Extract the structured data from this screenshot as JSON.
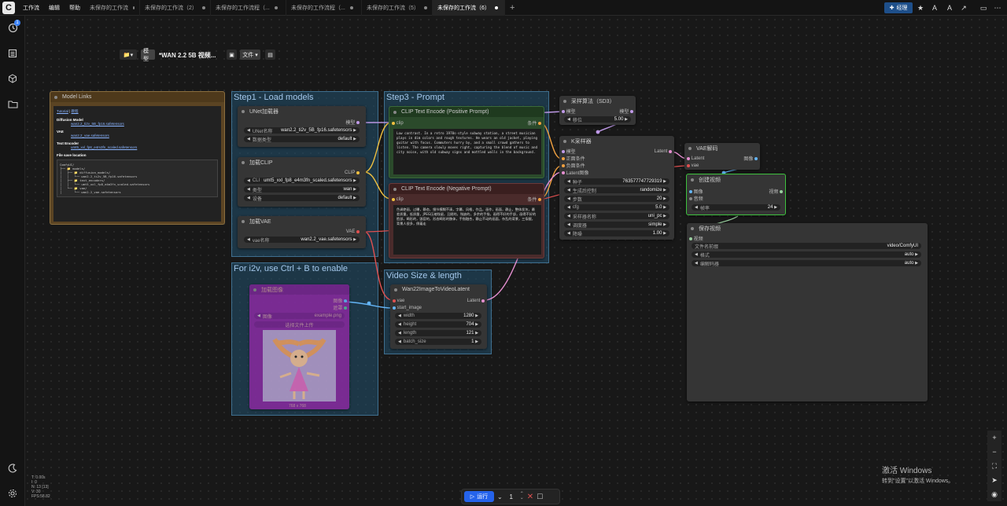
{
  "topbar": {
    "logo": "C",
    "menus": [
      "工作流",
      "编辑",
      "帮助"
    ],
    "tabs": [
      {
        "label": "未保存的工作流",
        "active": false
      },
      {
        "label": "未保存的工作流（2）",
        "active": false
      },
      {
        "label": "未保存的工作流程（...",
        "active": false
      },
      {
        "label": "未保存的工作流程（...",
        "active": false
      },
      {
        "label": "未保存的工作流（5）",
        "active": false
      },
      {
        "label": "未保存的工作流（6）",
        "active": true
      }
    ],
    "new_tab": "+",
    "manager_label": "经理"
  },
  "sidebar": {
    "queue_badge": "1"
  },
  "toolbar": {
    "model_label": "模型",
    "workflow_title": "*WAN 2.2 5B 视频...",
    "file_label": "文件"
  },
  "groups": {
    "step1": "Step1 - Load models",
    "step3": "Step3 - Prompt",
    "i2v": "For i2v, use Ctrl + B to enable",
    "video_size": "Video Size & length"
  },
  "notes": {
    "title": "Model Links",
    "tutorial": "Tutorial",
    "tutorial_sep": "|",
    "tutorial_cn": "教程",
    "diffusion_h": "Diffusion Model",
    "diffusion_link": "wan2.2_ti2v_5B_fp16.safetensors",
    "vae_h": "VAE",
    "vae_link": "wan2.2_vae.safetensors",
    "te_h": "Text Encoder",
    "te_link": "umt5_xxl_fp8_e4m3fn_scaled.safetensors",
    "save_h": "File save location",
    "tree": "ComfyUI/\n├── 📁 models/\n│   ├── 📁 diffusion_models/\n│   │   └── wan2.2_ti2v_5B_fp16.safetensors\n│   ├── 📁 text_encoders/\n│   │   └── umt5_xxl_fp8_e4m3fn_scaled.safetensors\n│   └── 📁 vae/\n│       └── wan2.2_vae.safetensors"
  },
  "unet": {
    "title": "UNet加载器",
    "out": "模型",
    "w1_label": "UNet名称",
    "w1_value": "wan2.2_ti2v_5B_fp16.safetensors",
    "w2_label": "数据类型",
    "w2_value": "default"
  },
  "clip_loader": {
    "title": "加载CLIP",
    "out": "CLIP",
    "w1_label": "CLI",
    "w1_value": "umt5_xxl_fp8_e4m3fn_scaled.safetensors",
    "w2_label": "类型",
    "w2_value": "wan",
    "w3_label": "设备",
    "w3_value": "default"
  },
  "vae_loader": {
    "title": "加载VAE",
    "out": "VAE",
    "w1_label": "vae名称",
    "w1_value": "wan2.2_vae.safetensors"
  },
  "pos_prompt": {
    "title": "CLIP Text Encode (Positive Prompt)",
    "in": "clip",
    "out": "条件",
    "text": "Low contrast. In a retro 1970s-style subway station, a street musician plays in dim colors and rough textures. He wears an old jacket, playing guitar with focus. Commuters hurry by, and a small crowd gathers to listen. The camera slowly moves right, capturing the blend of music and city noise, with old subway signs and mottled walls in the background."
  },
  "neg_prompt": {
    "title": "CLIP Text Encode (Negative Prompt)",
    "in": "clip",
    "out": "条件",
    "text": "色调艳丽，过曝，静态，细节模糊不清，字幕，风格，作品，画作，画面，静止，整体发灰，最差质量，低质量，JPEG压缩残留，丑陋的，残缺的，多余的手指，画得不好的手部，画得不好的脸部，畸形的，毁容的，形态畸形的肢体，手指融合，静止不动的画面，杂乱的背景，三条腿，背景人很多，倒着走"
  },
  "shift": {
    "title": "采样算法（SD3）",
    "in": "模型",
    "out": "模型",
    "w1_label": "移位",
    "w1_value": "5.00"
  },
  "ksampler": {
    "title": "K采样器",
    "inputs": [
      "模型",
      "正面条件",
      "负面条件",
      "Latent图像"
    ],
    "out": "Latent",
    "widgets": [
      {
        "label": "种子",
        "value": "763577747729319"
      },
      {
        "label": "生成后控制",
        "value": "randomize"
      },
      {
        "label": "步数",
        "value": "20"
      },
      {
        "label": "cfg",
        "value": "5.0"
      },
      {
        "label": "采样器名称",
        "value": "uni_pc"
      },
      {
        "label": "调度器",
        "value": "simple"
      },
      {
        "label": "降噪",
        "value": "1.00"
      }
    ]
  },
  "vae_decode": {
    "title": "VAE解码",
    "in1": "Latent",
    "in2": "vae",
    "out": "图像"
  },
  "create_video": {
    "title": "创建视频",
    "in1": "图像",
    "in2": "音频",
    "out": "视频",
    "w1_label": "帧率",
    "w1_value": "24"
  },
  "save_video": {
    "title": "保存视频",
    "in": "视频",
    "widgets": [
      {
        "label": "文件名前缀",
        "value": "video/ComfyUI"
      },
      {
        "label": "格式",
        "value": "auto"
      },
      {
        "label": "编解码器",
        "value": "auto"
      }
    ]
  },
  "load_image": {
    "title": "加载图像",
    "out1": "图像",
    "out2": "遮罩",
    "w1_label": "图像",
    "w1_value": "example.png",
    "upload": "选择文件上传",
    "caption": "768 x 768"
  },
  "wan_latent": {
    "title": "Wan22ImageToVideoLatent",
    "in1": "vae",
    "in2": "start_image",
    "out": "Latent",
    "widgets": [
      {
        "label": "width",
        "value": "1280"
      },
      {
        "label": "height",
        "value": "704"
      },
      {
        "label": "length",
        "value": "121"
      },
      {
        "label": "batch_size",
        "value": "1"
      }
    ]
  },
  "runbar": {
    "run_label": "运行",
    "count": "1"
  },
  "stats": [
    "T: 0.00s",
    "I: 0",
    "N: 13 [13]",
    "V: 30",
    "FPS:58.82"
  ],
  "watermark": {
    "line1": "激活 Windows",
    "line2": "转到\"设置\"以激活 Windows。"
  },
  "colors": {
    "accent": "#2563eb",
    "group": "#1f4a66",
    "pos_node": "#2f5a2f",
    "neg_node": "#5a2f2f",
    "link_pink": "#e58fd0",
    "link_yellow": "#f0c040",
    "link_red": "#e05050"
  }
}
